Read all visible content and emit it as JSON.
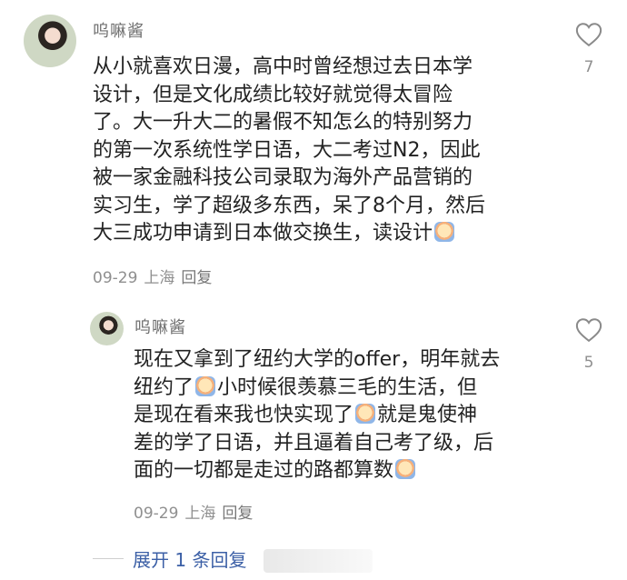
{
  "comments": [
    {
      "username": "呜嘛酱",
      "lines": [
        "从小就喜欢日漫，高中时曾经想过去日本学",
        "设计，但是文化成绩比较好就觉得太冒险",
        "了。大一升大二的暑假不知怎么的特别努力",
        "的第一次系统性学日语，大二考过N2，因此",
        "被一家金融科技公司录取为海外产品营销的",
        "实习生，学了超级多东西，呆了8个月，然后",
        "大三成功申请到日本做交换生，读设计"
      ],
      "emoji": "crying-emoji",
      "date": "09-29",
      "location": "上海",
      "reply_label": "回复",
      "likes": "7"
    },
    {
      "username": "呜嘛酱",
      "lines": [
        "现在又拿到了纽约大学的offer，明年就去",
        "纽约了",
        "小时候很羡慕三毛的生活，但",
        "是现在看来我也快实现了",
        "就是鬼使神",
        "差的学了日语，并且逼着自己考了级，后",
        "面的一切都是走过的路都算数"
      ],
      "emoji": "crying-emoji",
      "date": "09-29",
      "location": "上海",
      "reply_label": "回复",
      "likes": "5"
    }
  ],
  "expand_label": "展开 1 条回复",
  "colors": {
    "link": "#3b5fa6",
    "meta": "#8f8f8f",
    "text": "#222222"
  },
  "icons": {
    "like": "heart-outline-icon"
  }
}
